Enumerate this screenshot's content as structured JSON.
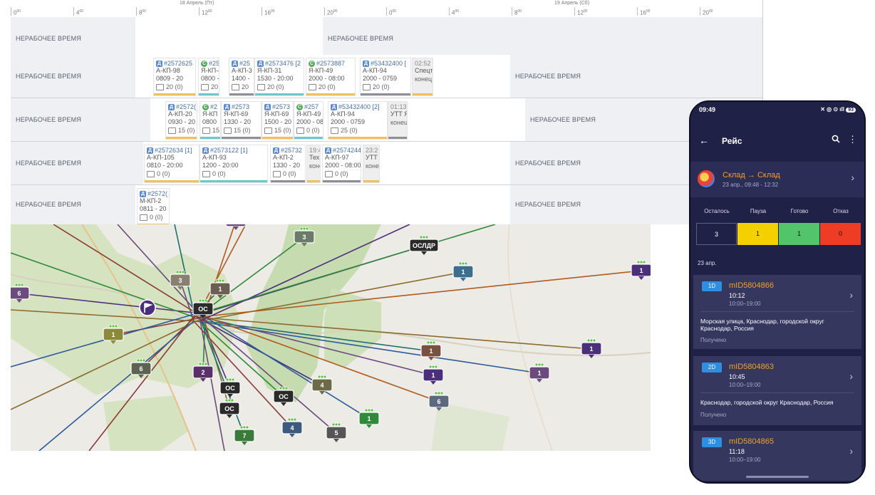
{
  "schedule": {
    "days": [
      "18 Апрель (Пт)",
      "19 Апрель (Сб)"
    ],
    "ticks": [
      "0",
      "4",
      "8",
      "12",
      "16",
      "20",
      "0",
      "4",
      "8",
      "12",
      "16",
      "20"
    ],
    "tick_sup": "00",
    "off_label": "НЕРАБОЧЕЕ ВРЕМЯ",
    "rows": [
      {
        "cards": []
      },
      {
        "cards": [
          {
            "badge": "Д",
            "id": "#2572625",
            "from": "А-КП-98",
            "time": "0809 - 20",
            "count": "20 (0)"
          },
          {
            "badge": "С",
            "id": "#25",
            "from": "Я-КП-4",
            "time": "0800 -",
            "count": "20"
          },
          {
            "badge": "Д",
            "id": "#25",
            "from": "А-КП-3",
            "time": "1400 -",
            "count": "20"
          },
          {
            "badge": "Д",
            "id": "#2573476 [2",
            "from": "Я-КП-31",
            "time": "1530 - 20:00",
            "count": "20 (0)"
          },
          {
            "badge": "С",
            "id": "#2573887",
            "from": "Я-КП-49",
            "time": "2000 - 08:00",
            "count": "20 (0)"
          },
          {
            "badge": "Д",
            "id": "#53432400 [",
            "from": "А-КП-94",
            "time": "2000 - 0759",
            "count": "20 (0)"
          },
          {
            "badge": "",
            "id": "02:52",
            "from": "Спецт",
            "time": "",
            "count": "конец"
          }
        ]
      },
      {
        "cards": [
          {
            "badge": "Д",
            "id": "#2572(",
            "from": "А-КП-20",
            "time": "0930 - 20",
            "count": "15 (0)"
          },
          {
            "badge": "С",
            "id": "#2",
            "from": "Я-КП",
            "time": "0800",
            "count": "15"
          },
          {
            "badge": "Д",
            "id": "#2573",
            "from": "Я-КП-69",
            "time": "1330 - 20",
            "count": "15 (0)"
          },
          {
            "badge": "Д",
            "id": "#2573",
            "from": "Я-КП-69",
            "time": "1500 - 20",
            "count": "15 (0)"
          },
          {
            "badge": "С",
            "id": "#257",
            "from": "Я-КП-49",
            "time": "2000 - 08",
            "count": "0 (0)"
          },
          {
            "badge": "Д",
            "id": "#53432400 [2]",
            "from": "А-КП-94",
            "time": "2000 - 0759",
            "count": "25 (0)"
          },
          {
            "badge": "",
            "id": "01:13",
            "from": "УТТ Я",
            "time": "",
            "count": "конец"
          }
        ]
      },
      {
        "cards": [
          {
            "badge": "Д",
            "id": "#2572634 [1]",
            "from": "А-КП-105",
            "time": "0810 - 20:00",
            "count": "0 (0)"
          },
          {
            "badge": "Д",
            "id": "#2573122 [1]",
            "from": "А-КП-93",
            "time": "1200 - 20:00",
            "count": "0 (0)"
          },
          {
            "badge": "Д",
            "id": "#25732",
            "from": "А-КП-2",
            "time": "1330 - 20",
            "count": "0 (0)"
          },
          {
            "badge": "",
            "id": "19:4",
            "from": "Тех",
            "time": "",
            "count": "конец"
          },
          {
            "badge": "Д",
            "id": "#2574244",
            "from": "А-КП-97",
            "time": "2000 - 08:00",
            "count": "0 (0)"
          },
          {
            "badge": "",
            "id": "23:2",
            "from": "УТТ",
            "time": "",
            "count": "конец"
          }
        ]
      },
      {
        "cards": [
          {
            "badge": "Д",
            "id": "#2572(",
            "from": "М-КП-2",
            "time": "0811 - 20",
            "count": "0 (0)"
          }
        ]
      }
    ]
  },
  "map": {
    "markers": [
      "6",
      "3",
      "1",
      "ОС",
      "1",
      "3",
      "1",
      "1",
      "ОС",
      "2",
      "1",
      "1",
      "6",
      "1",
      "1",
      "6",
      "4",
      "ОС",
      "ОС",
      "1",
      "4",
      "5",
      "7",
      "1",
      "ОСЛДР"
    ]
  },
  "phone": {
    "time": "09:49",
    "signal_icons": "✕ ◎ ⊙ ıll",
    "battery": "93",
    "title": "Рейс",
    "route_title": "Склад → Склад",
    "route_sub": "23 апр., 09:48 - 12:32",
    "counters": [
      {
        "label": "Осталось",
        "value": "3",
        "color": "#1f2147",
        "text": "#ffffff"
      },
      {
        "label": "Пауза",
        "value": "1",
        "color": "#f5d000",
        "text": "#111111"
      },
      {
        "label": "Готово",
        "value": "1",
        "color": "#52c46a",
        "text": "#111111"
      },
      {
        "label": "Отказ",
        "value": "0",
        "color": "#ee3d24",
        "text": "#111111"
      }
    ],
    "date": "23 апр.",
    "stops": [
      {
        "tag": "1D",
        "id": "mID5804866",
        "time": "10:12",
        "window": "10:00–19:00",
        "addr": "Морская улица, Краснодар, городской округ Краснодар, Россия",
        "status": "Получено"
      },
      {
        "tag": "2D",
        "id": "mID5804863",
        "time": "10:45",
        "window": "10:00–19:00",
        "addr": "Краснодар, городской округ Краснодар, Россия",
        "status": "Получено"
      },
      {
        "tag": "3D",
        "id": "mID5804865",
        "time": "11:18",
        "window": "10:00–19:00",
        "addr": "",
        "status": ""
      }
    ]
  }
}
